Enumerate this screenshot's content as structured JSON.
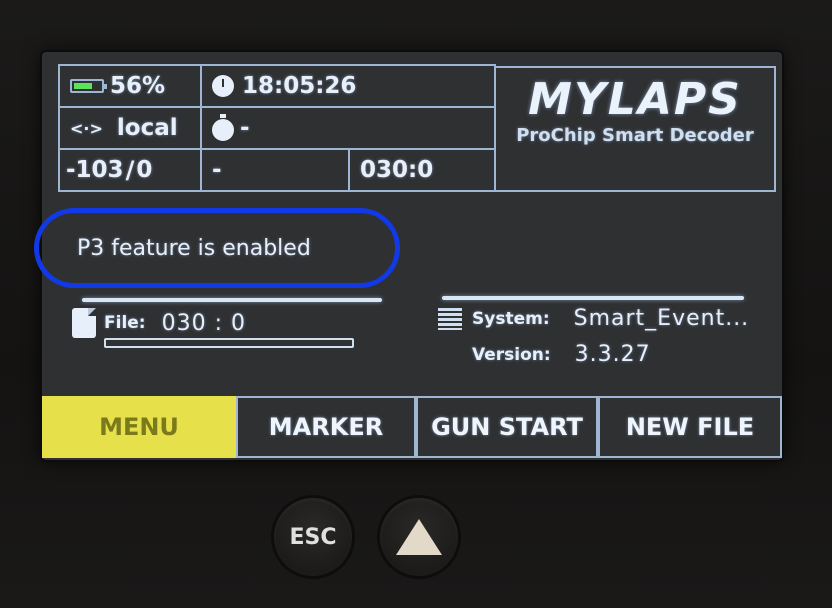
{
  "status": {
    "battery": "56%",
    "time": "18:05:26",
    "connection": "local",
    "stopwatch": "-",
    "signal": "-103",
    "signal_value": "0",
    "cell_dash": "-",
    "counter": "030:0"
  },
  "brand": {
    "logo": "MYLAPS",
    "subtitle": "ProChip Smart Decoder"
  },
  "notice": "P3 feature is enabled",
  "file": {
    "label": "File:",
    "value": "030 : 0"
  },
  "system": {
    "system_label": "System:",
    "system_value": "Smart_Event...",
    "version_label": "Version:",
    "version_value": "3.3.27"
  },
  "softkeys": [
    "MENU",
    "MARKER",
    "GUN START",
    "NEW FILE"
  ],
  "hardware": {
    "esc": "ESC"
  },
  "colors": {
    "highlight_ring": "#1239e6",
    "menu_key": "#e6e04a",
    "battery_fill": "#5de35a"
  }
}
